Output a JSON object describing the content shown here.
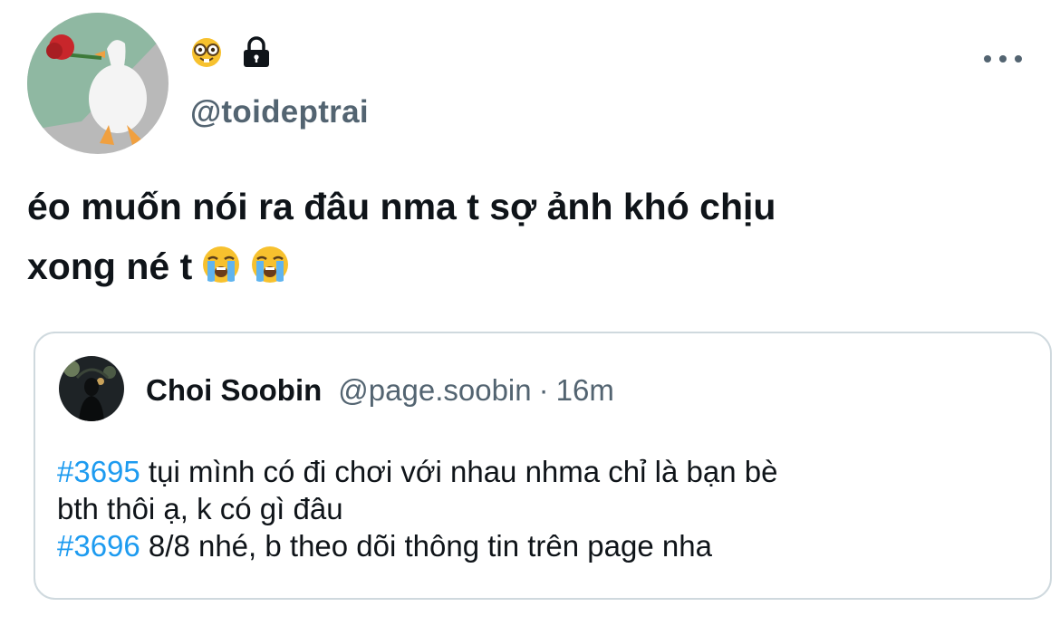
{
  "author": {
    "handle": "@toideptrai",
    "avatar_icon": "goose-with-rose-avatar",
    "badges": [
      "nerd-face-emoji",
      "lock-icon"
    ]
  },
  "menu": {
    "icon": "more-options-icon"
  },
  "tweet": {
    "line1": "éo muốn nói ra đâu nma t sợ ảnh khó chịu",
    "line2": "xong né t",
    "emojis": [
      "loudly-crying-face-emoji",
      "loudly-crying-face-emoji"
    ]
  },
  "quote": {
    "name": "Choi Soobin",
    "handle": "@page.soobin",
    "separator": "·",
    "time": "16m",
    "avatar_icon": "dark-night-photo-avatar",
    "line1_tag": "#3695",
    "line1_text": " tụi mình có đi chơi với nhau nhma  chỉ là bạn bè",
    "line2_text": "bth thôi ạ, k có gì đâu",
    "line3_tag": "#3696",
    "line3_text": " 8/8 nhé, b theo dõi thông tin trên page nha"
  },
  "colors": {
    "text": "#0f1419",
    "secondary": "#536471",
    "hashtag": "#1d9bf0",
    "border": "#cfd9de"
  }
}
